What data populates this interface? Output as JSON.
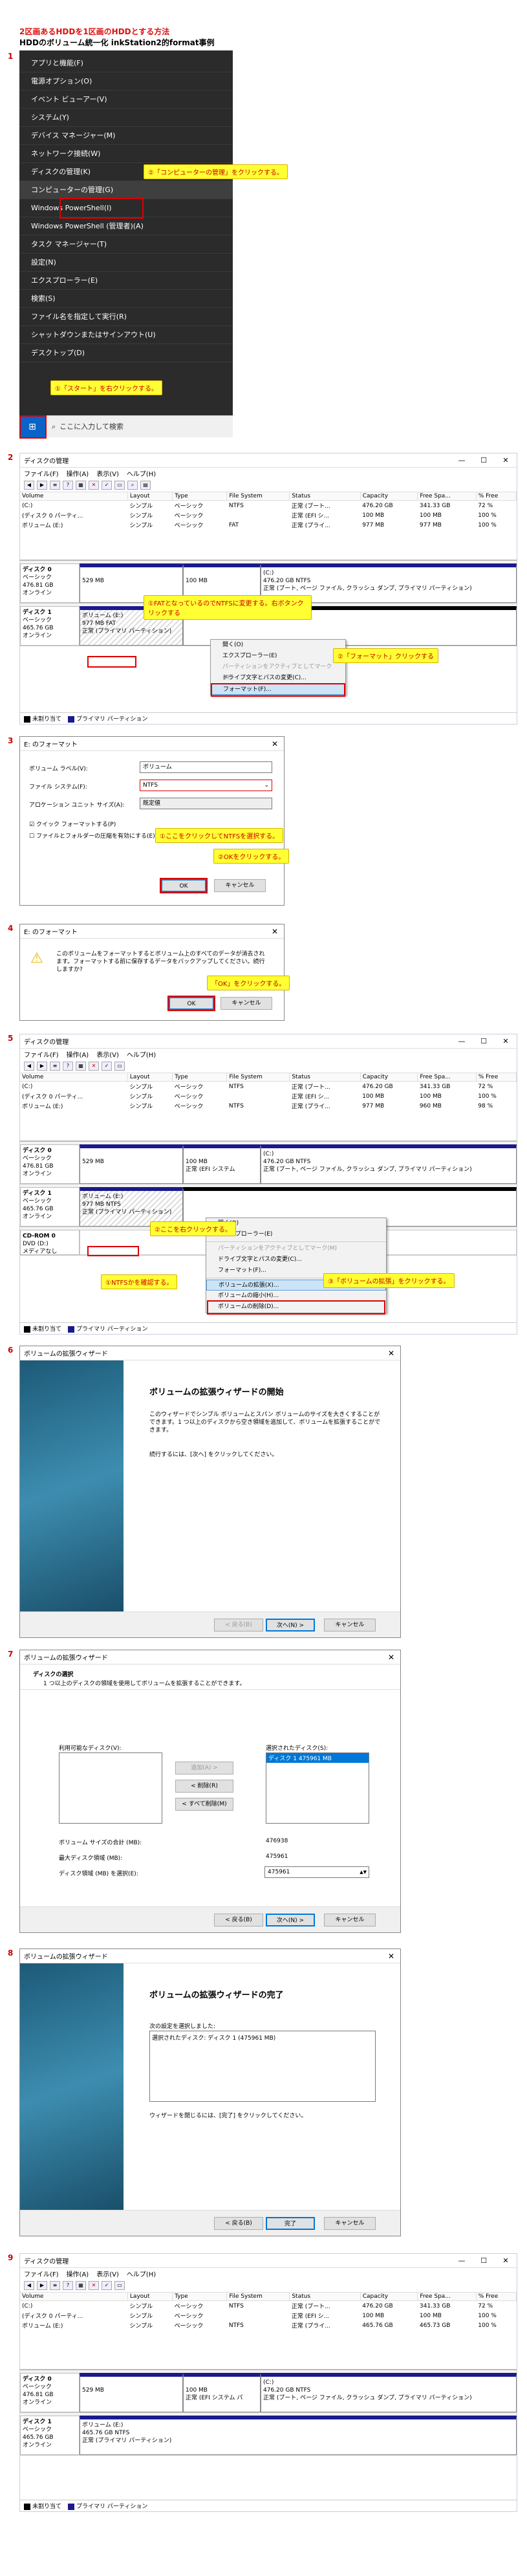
{
  "header": {
    "title": "2区画あるHDDを1区画のHDDとする方法",
    "subtitle": "HDDのボリューム統一化 inkStation2的format事例"
  },
  "steps": [
    "1",
    "2",
    "3",
    "4",
    "5",
    "6",
    "7",
    "8",
    "9"
  ],
  "step1": {
    "menu_items": [
      "アプリと機能(F)",
      "電源オプション(O)",
      "イベント ビューアー(V)",
      "システム(Y)",
      "デバイス マネージャー(M)",
      "ネットワーク接続(W)",
      "ディスクの管理(K)",
      "コンピューターの管理(G)",
      "Windows PowerShell(I)",
      "Windows PowerShell (管理者)(A)",
      "タスク マネージャー(T)",
      "設定(N)",
      "エクスプローラー(E)",
      "検索(S)",
      "ファイル名を指定して実行(R)",
      "シャットダウンまたはサインアウト(U)",
      "デスクトップ(D)"
    ],
    "callout_manage": "②「コンピューターの管理」をクリックする。",
    "callout_start": "①「スタート」を右クリックする。",
    "search_placeholder": "ここに入力して検索",
    "win_icon": "windows-logo-icon",
    "search_icon": "search-icon"
  },
  "dm": {
    "title": "ディスクの管理",
    "menus": [
      "ファイル(F)",
      "操作(A)",
      "表示(V)",
      "ヘルプ(H)"
    ],
    "controls": [
      "—",
      "☐",
      "✕"
    ],
    "columns": [
      "Volume",
      "Layout",
      "Type",
      "File System",
      "Status",
      "Capacity",
      "Free Spa...",
      "% Free"
    ],
    "legend_unalloc": "未割り当て",
    "legend_primary": "プライマリ パーティション"
  },
  "step2": {
    "rows": [
      [
        "(C:)",
        "シンプル",
        "ベーシック",
        "NTFS",
        "正常 (ブート...",
        "476.20 GB",
        "341.33 GB",
        "72 %"
      ],
      [
        "(ディスク 0 パーティ...",
        "シンプル",
        "ベーシック",
        "",
        "正常 (EFI シ...",
        "100 MB",
        "100 MB",
        "100 %"
      ],
      [
        "ボリューム (E:)",
        "シンプル",
        "ベーシック",
        "FAT",
        "正常 (プライ...",
        "977 MB",
        "977 MB",
        "100 %"
      ]
    ],
    "disk0": {
      "name": "ディスク 0",
      "type": "ベーシック",
      "size": "476.81 GB",
      "status": "オンライン",
      "p1": "529 MB",
      "p2": "100 MB",
      "p3_name": "(C:)",
      "p3_size": "476.20 GB NTFS",
      "p3_status": "正常 (ブート, ページ ファイル, クラッシュ ダンプ, プライマリ パーティション)"
    },
    "disk1": {
      "name": "ディスク 1",
      "type": "ベーシック",
      "size": "465.76 GB",
      "status": "オンライン",
      "p1_name": "ボリューム (E:)",
      "p1_size": "977 MB FAT",
      "p1_status": "正常 (プライマリ パーティション)"
    },
    "callout_fat": "①FATとなっているのでNTFSに変更する。右ボタンクリックする",
    "callout_format": "②「フォーマット」クリックする",
    "ctx": [
      "開く(O)",
      "エクスプローラー(E)",
      "パーティションをアクティブとしてマーク(M)",
      "ドライブ文字とパスの変更(C)...",
      "フォーマット(F)..."
    ]
  },
  "step3": {
    "title": "E: のフォーマット",
    "label_vol": "ボリューム ラベル(V):",
    "val_vol": "ボリューム",
    "label_fs": "ファイル システム(F):",
    "val_fs": "NTFS",
    "label_au": "アロケーション ユニット サイズ(A):",
    "val_au": "既定値",
    "chk1": "クイック フォーマットする(P)",
    "chk2": "ファイルとフォルダーの圧縮を有効にする(E)",
    "ok": "OK",
    "cancel": "キャンセル",
    "callout_ntfs": "①ここをクリックしてNTFSを選択する。",
    "callout_ok": "②OKをクリックする。"
  },
  "step4": {
    "title": "E: のフォーマット",
    "msg": "このボリュームをフォーマットするとボリューム上のすべてのデータが消去されます。フォーマットする前に保存するデータをバックアップしてください。続行しますか?",
    "ok": "OK",
    "cancel": "キャンセル",
    "callout": "「OK」をクリックする。"
  },
  "step5": {
    "rows": [
      [
        "(C:)",
        "シンプル",
        "ベーシック",
        "NTFS",
        "正常 (ブート...",
        "476.20 GB",
        "341.33 GB",
        "72 %"
      ],
      [
        "(ディスク 0 パーティ...",
        "シンプル",
        "ベーシック",
        "",
        "正常 (EFI シ...",
        "100 MB",
        "100 MB",
        "100 %"
      ],
      [
        "ボリューム (E:)",
        "シンプル",
        "ベーシック",
        "NTFS",
        "正常 (プライ...",
        "977 MB",
        "960 MB",
        "98 %"
      ]
    ],
    "disk0": {
      "name": "ディスク 0",
      "type": "ベーシック",
      "size": "476.81 GB",
      "status": "オンライン",
      "p1": "529 MB",
      "p2": "100 MB",
      "p2b": "正常 (EFI システム",
      "p3_name": "(C:)",
      "p3_size": "476.20 GB NTFS",
      "p3_status": "正常 (ブート, ページ ファイル, クラッシュ ダンプ, プライマリ パーティション)"
    },
    "disk1": {
      "name": "ディスク 1",
      "type": "ベーシック",
      "size": "465.76 GB",
      "status": "オンライン",
      "p1_name": "ボリューム (E:)",
      "p1_size": "977 MB NTFS",
      "p1_status": "正常 (プライマリ パーティション)"
    },
    "cdrom": {
      "name": "CD-ROM 0",
      "type": "DVD (D:)",
      "status": "メディアなし"
    },
    "callout_right": "②ここを右クリックする。",
    "callout_ntfs": "①NTFSかを確認する。",
    "callout_extend": "③「ボリュームの拡張」をクリックする。",
    "ctx": [
      "開く(O)",
      "エクスプローラー(E)",
      "パーティションをアクティブとしてマーク(M)",
      "ドライブ文字とパスの変更(C)...",
      "フォーマット(F)...",
      "ボリュームの拡張(X)...",
      "ボリュームの縮小(H)...",
      "ボリュームの削除(D)..."
    ]
  },
  "step6": {
    "title": "ボリュームの拡張ウィザード",
    "heading": "ボリュームの拡張ウィザードの開始",
    "body": "このウィザードでシンプル ボリュームとスパン ボリュームのサイズを大きくすることができます。1 つ以上のディスクから空き領域を追加して、ボリュームを拡張することができます。",
    "cont": "続行するには、[次へ] をクリックしてください。",
    "back": "< 戻る(B)",
    "next": "次へ(N) >",
    "cancel": "キャンセル"
  },
  "step7": {
    "title": "ボリュームの拡張ウィザード",
    "heading": "ディスクの選択",
    "sub": "1 つ以上のディスクの領域を使用してボリュームを拡張することができます。",
    "avail": "利用可能なディスク(V):",
    "selected": "選択されたディスク(S):",
    "sel_item": "ディスク 1     475961 MB",
    "add": "追加(A) >",
    "remove": "< 削除(R)",
    "remove_all": "< すべて削除(M)",
    "l_total": "ボリューム サイズの合計 (MB):",
    "v_total": "476938",
    "l_max": "最大ディスク領域 (MB):",
    "v_max": "475961",
    "l_amount": "ディスク領域 (MB) を選択(E):",
    "v_amount": "475961",
    "back": "< 戻る(B)",
    "next": "次へ(N) >",
    "cancel": "キャンセル"
  },
  "step8": {
    "title": "ボリュームの拡張ウィザード",
    "heading": "ボリュームの拡張ウィザードの完了",
    "sel": "次の設定を選択しました:",
    "sel_val": "選択されたディスク: ディスク 1 (475961 MB)",
    "close": "ウィザードを閉じるには、[完了] をクリックしてください。",
    "back": "< 戻る(B)",
    "finish": "完了",
    "cancel": "キャンセル"
  },
  "step9": {
    "rows": [
      [
        "(C:)",
        "シンプル",
        "ベーシック",
        "NTFS",
        "正常 (ブート...",
        "476.20 GB",
        "341.33 GB",
        "72 %"
      ],
      [
        "(ディスク 0 パーティ...",
        "シンプル",
        "ベーシック",
        "",
        "正常 (EFI シ...",
        "100 MB",
        "100 MB",
        "100 %"
      ],
      [
        "ボリューム (E:)",
        "シンプル",
        "ベーシック",
        "NTFS",
        "正常 (プライ...",
        "465.76 GB",
        "465.73 GB",
        "100 %"
      ]
    ],
    "disk0": {
      "name": "ディスク 0",
      "type": "ベーシック",
      "size": "476.81 GB",
      "status": "オンライン",
      "p1": "529 MB",
      "p2": "100 MB",
      "p2b": "正常 (EFI システム パ",
      "p3_name": "(C:)",
      "p3_size": "476.20 GB NTFS",
      "p3_status": "正常 (ブート, ページ ファイル, クラッシュ ダンプ, プライマリ パーティション)"
    },
    "disk1": {
      "name": "ディスク 1",
      "type": "ベーシック",
      "size": "465.76 GB",
      "status": "オンライン",
      "p1_name": "ボリューム (E:)",
      "p1_size": "465.76 GB NTFS",
      "p1_status": "正常 (プライマリ パーティション)"
    }
  },
  "colors": {
    "accent": "#0078d7",
    "callout": "#ffff33",
    "red": "#d00000",
    "disk_bar": "#1a1a8c"
  }
}
